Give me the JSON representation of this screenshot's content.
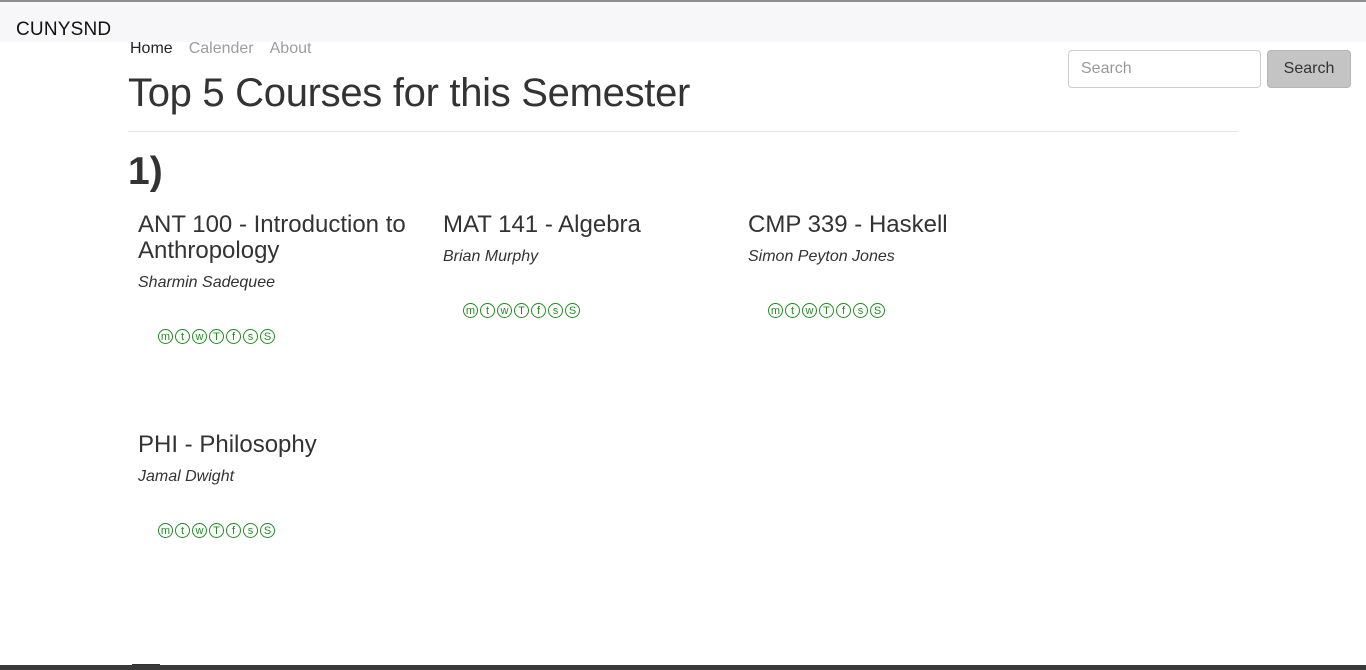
{
  "app": {
    "brand": "CUNYSND"
  },
  "nav": {
    "items": [
      "Home",
      "Calender",
      "About"
    ]
  },
  "search": {
    "placeholder": "Search",
    "button_label": "Search"
  },
  "page": {
    "title": "Top 5 Courses for this Semester",
    "section_number": "1)"
  },
  "days_of_week": [
    "m",
    "t",
    "w",
    "T",
    "f",
    "s",
    "S"
  ],
  "courses": [
    {
      "title": "ANT 100 - Introduction to Anthropology",
      "instructor": "Sharmin Sadequee"
    },
    {
      "title": "MAT 141 - Algebra",
      "instructor": "Brian Murphy"
    },
    {
      "title": "CMP 339 - Haskell",
      "instructor": "Simon Peyton Jones"
    },
    {
      "title": "PHI - Philosophy",
      "instructor": "Jamal Dwight"
    }
  ],
  "colors": {
    "day_circle": "#228b22",
    "nav_inactive": "#9d9d9d",
    "header_bg": "#f7f7f9"
  }
}
